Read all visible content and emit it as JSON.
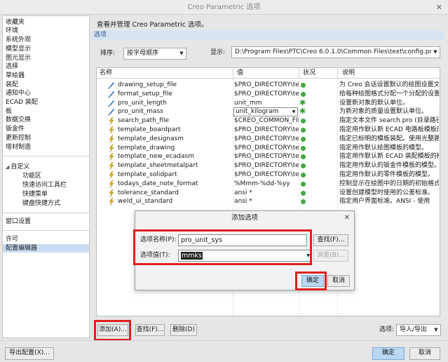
{
  "window": {
    "title": "Creo Parametric 选项",
    "close_glyph": "✕"
  },
  "sidebar": {
    "items": [
      {
        "label": "收藏夹",
        "sub": false
      },
      {
        "label": "环境",
        "sub": false
      },
      {
        "label": "系统外观",
        "sub": false
      },
      {
        "label": "模型显示",
        "sub": false
      },
      {
        "label": "图元显示",
        "sub": false
      },
      {
        "label": "选择",
        "sub": false
      },
      {
        "label": "草绘器",
        "sub": false
      },
      {
        "label": "装配",
        "sub": false
      },
      {
        "label": "通知中心",
        "sub": false
      },
      {
        "label": "ECAD 装配",
        "sub": false
      },
      {
        "label": "板",
        "sub": false
      },
      {
        "label": "数据交换",
        "sub": false
      },
      {
        "label": "钣金件",
        "sub": false
      },
      {
        "label": "更新控制",
        "sub": false
      },
      {
        "label": "增材制造",
        "sub": false
      }
    ],
    "customize": {
      "label": "自定义",
      "children": [
        "功能区",
        "快速访问工具栏",
        "快捷菜单",
        "键盘快捷方式"
      ]
    },
    "window_settings": "窗口设置",
    "license": "许可",
    "config_editor": "配置编辑器"
  },
  "main": {
    "description": "查看并管理 Creo Parametric 选项。",
    "section_header": "选项",
    "sort_label": "排序:",
    "sort_value": "按字母顺序",
    "show_label": "显示:",
    "show_value": "D:\\Program Files\\PTC\\Creo 6.0.1.0\\Common Files\\text\\config.pro"
  },
  "table": {
    "headers": {
      "name": "名称",
      "value": "值",
      "status": "状况",
      "description": "说明"
    },
    "rows": [
      {
        "icon": "pen-icon",
        "name": "drawing_setup_file",
        "value": "$PRO_DIRECTORY\\tex",
        "status": "dot",
        "desc": "为 Creo 会话设置默认的绘图设置文件"
      },
      {
        "icon": "pen-icon",
        "name": "format_setup_file",
        "value": "$PRO_DIRECTORY\\tex",
        "status": "dot",
        "desc": "给每种绘图格式分配一个分配的设置文"
      },
      {
        "icon": "pen-icon",
        "name": "pro_unit_length",
        "value": "unit_mm",
        "status": "star",
        "desc": "设置新对象的默认单位。"
      },
      {
        "icon": "pen-icon",
        "name": "pro_unit_mass",
        "value": "unit_kilogram",
        "status": "star",
        "desc": "为新对象的质量设置默认单位。",
        "combo": true
      },
      {
        "icon": "bolt-icon",
        "name": "search_path_file",
        "value": "$CREO_COMMON_FIL",
        "status": "dot",
        "desc": "指定文本文件 search.pro (目录路径"
      },
      {
        "icon": "bolt-icon",
        "name": "template_boardpart",
        "value": "$PRO_DIRECTORY\\tex",
        "status": "dot",
        "desc": "指定用作默认新 ECAD 电路板模板的"
      },
      {
        "icon": "bolt-icon",
        "name": "template_designasm",
        "value": "$PRO_DIRECTORY\\tex",
        "status": "dot",
        "desc": "指定已标明的模板装配。使用光整路径"
      },
      {
        "icon": "bolt-icon",
        "name": "template_drawing",
        "value": "$PRO_DIRECTORY\\tex",
        "status": "dot",
        "desc": "指定用作默认绘图模板的模型。"
      },
      {
        "icon": "bolt-icon",
        "name": "template_new_ecadasm",
        "value": "$PRO_DIRECTORY\\tex",
        "status": "dot",
        "desc": "指定用作默认新 ECAD 装配模板的模"
      },
      {
        "icon": "bolt-icon",
        "name": "template_sheetmetalpart",
        "value": "$PRO_DIRECTORY\\tex",
        "status": "dot",
        "desc": "指定用作默认的钣金件模板的模型。"
      },
      {
        "icon": "bolt-icon",
        "name": "template_solidpart",
        "value": "$PRO_DIRECTORY\\tex",
        "status": "dot",
        "desc": "指定用作默认的零件模板的模型。"
      },
      {
        "icon": "bolt-icon",
        "name": "todays_date_note_format",
        "value": "%Mmm-%dd-%yy",
        "status": "dot",
        "desc": "控制显示在绘图中的日期的初始格式。"
      },
      {
        "icon": "bolt-icon",
        "name": "tolerance_standard",
        "value": "ansi *",
        "status": "dot",
        "desc": "设置创建模型时使用的公差标准。"
      },
      {
        "icon": "bolt-icon",
        "name": "weld_ui_standard",
        "value": "ansi *",
        "status": "dot",
        "desc": "指定用户界面标准。ANSI - 使用"
      }
    ]
  },
  "bottom": {
    "add": "添加(A)...",
    "find": "查找(F)...",
    "delete": "删除(D)",
    "options_label": "选项:",
    "options_value": "导入/导出"
  },
  "footer": {
    "export": "导出配置(X)...",
    "ok": "确定",
    "cancel": "取消"
  },
  "dialog": {
    "title": "添加选项",
    "close_glyph": "✕",
    "name_label": "选项名称(P):",
    "name_value": "pro_unit_sys",
    "find_button": "查找(F)...",
    "value_label": "选项值(T):",
    "value_value": "mmks",
    "browse_button": "浏览(B)...",
    "ok": "确定",
    "cancel": "取消"
  },
  "colors": {
    "highlight": "#e02020",
    "selection": "#c9ddf1",
    "primary_button": "#bcd7f3",
    "status_green": "#3dab3d"
  }
}
